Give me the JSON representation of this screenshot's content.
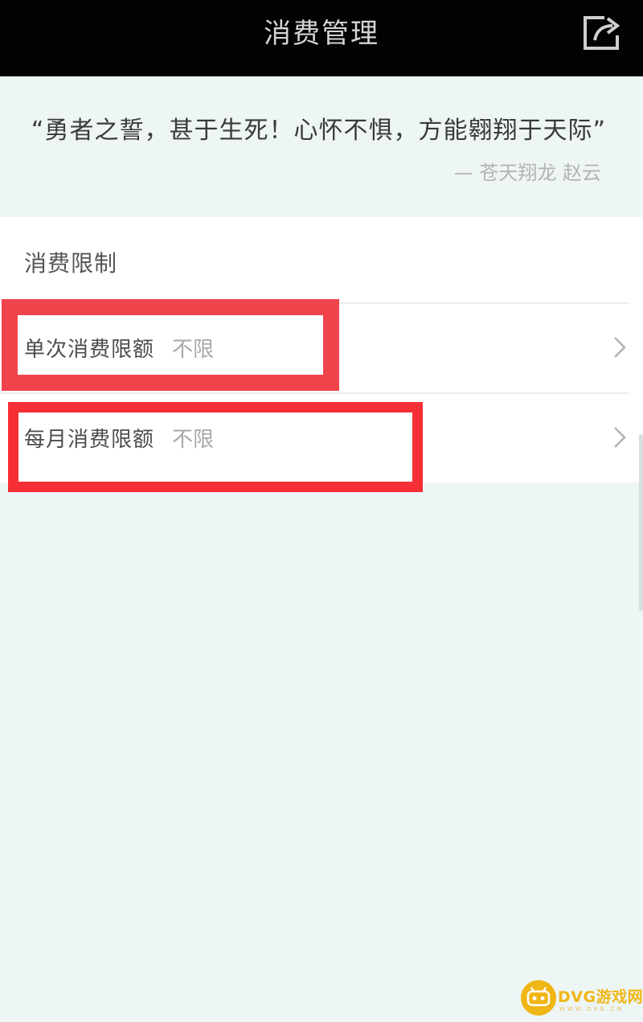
{
  "header": {
    "title": "消费管理",
    "share_icon": "share-icon"
  },
  "quote": {
    "text": "“勇者之誓，甚于生死！心怀不惧，方能翱翔于天际”",
    "author": "— 苍天翔龙 赵云"
  },
  "section": {
    "title": "消费限制",
    "items": [
      {
        "label": "单次消费限额",
        "value": "不限",
        "icon": "chevron-right-icon"
      },
      {
        "label": "每月消费限额",
        "value": "不限",
        "icon": "chevron-right-icon"
      }
    ]
  },
  "annotations": {
    "highlight_color": "#f0444c"
  },
  "watermark": {
    "text": "DVG游戏网",
    "subtext": "WWW.DVG.CN",
    "color": "#f0b614"
  }
}
